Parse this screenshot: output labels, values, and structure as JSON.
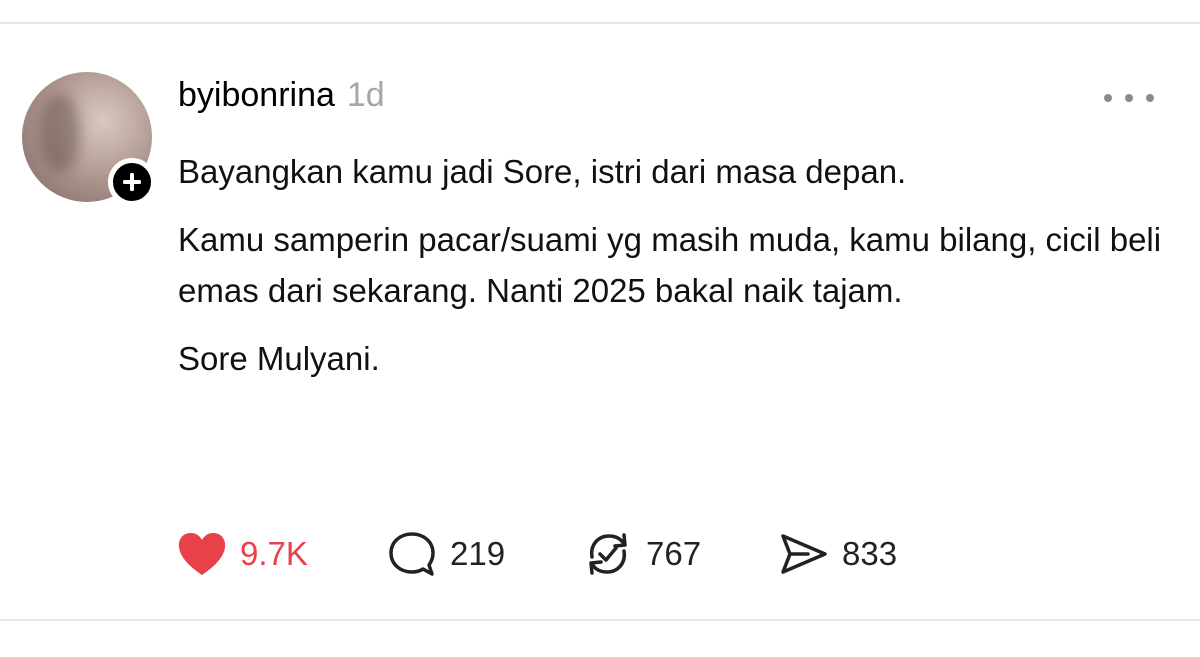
{
  "post": {
    "username": "byibonrina",
    "timestamp": "1d",
    "paragraphs": [
      "Bayangkan kamu jadi Sore, istri dari masa depan.",
      "Kamu samperin pacar/suami yg masih muda, kamu bilang, cicil beli emas dari sekarang. Nanti 2025 bakal naik tajam.",
      "Sore Mulyani."
    ],
    "actions": {
      "like_count": "9.7K",
      "reply_count": "219",
      "repost_count": "767",
      "share_count": "833"
    }
  },
  "icons": {
    "avatar": "avatar-image",
    "follow": "plus-icon",
    "more": "more-dots-icon",
    "like": "heart-icon",
    "reply": "speech-bubble-icon",
    "repost": "repost-check-icon",
    "share": "send-icon"
  },
  "colors": {
    "like_active": "#e8414a",
    "text": "#000000",
    "muted": "#a6a6a6",
    "badge": "#000000"
  }
}
